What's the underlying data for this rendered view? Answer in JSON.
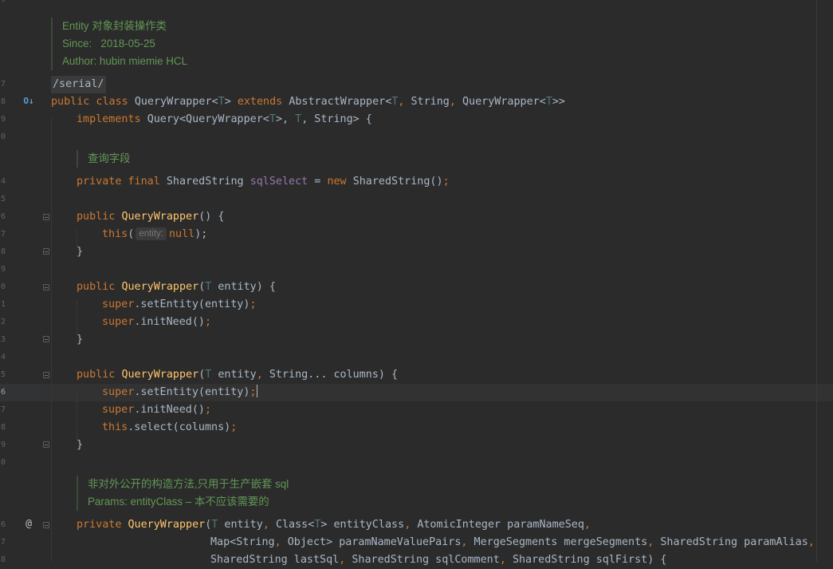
{
  "gutter": {
    "line_numbers": [
      "9",
      "7",
      "8",
      "9",
      "0",
      "4",
      "5",
      "6",
      "7",
      "8",
      "9",
      "0",
      "1",
      "2",
      "3",
      "4",
      "5",
      "6",
      "7",
      "8",
      "9",
      "0",
      "6",
      "7",
      "8"
    ],
    "implements_icon_label": "O↓",
    "annotation_icon_label": "@"
  },
  "doc_class": {
    "line1": "Entity 对象封装操作类",
    "line2": "Since:   2018-05-25",
    "line3": "Author: hubin miemie HCL"
  },
  "doc_field": {
    "line1": "查询字段"
  },
  "doc_ctor": {
    "line1": "非对外公开的构造方法,只用于生产嵌套 sql",
    "line2": "Params: entityClass – 本不应该需要的"
  },
  "code": {
    "serial": "/serial/",
    "l_class": {
      "kw1": "public class ",
      "name": "QueryWrapper",
      "t1": "<",
      "tp1": "T",
      "t2": "> ",
      "kw2": "extends ",
      "base": "AbstractWrapper<",
      "tp2": "T",
      "c1": ", ",
      "s1": "String",
      "c2": ", ",
      "q1": "QueryWrapper<",
      "tp3": "T",
      "end": ">>"
    },
    "l_impl": {
      "kw": "implements ",
      "a": "Query<QueryWrapper<",
      "tp1": "T",
      "b": ">, ",
      "tp2": "T",
      "c": ", String> {"
    },
    "l_field": {
      "kw": "private final ",
      "type": "SharedString ",
      "name": "sqlSelect",
      "eq": " = ",
      "kwnew": "new ",
      "rest": "SharedString()",
      "semi": ";"
    },
    "l_c1": {
      "kw": "public ",
      "name": "QueryWrapper",
      "rest": "() {"
    },
    "l_c1b": {
      "kw": "this",
      "p": "(",
      "hint": "entity:",
      "kwnull": "null",
      "end": ");"
    },
    "brace": "}",
    "l_c2": {
      "kw": "public ",
      "name": "QueryWrapper",
      "p": "(",
      "tp": "T",
      "rest": " entity) {"
    },
    "l_c2a": {
      "kw": "super",
      "rest": ".setEntity(entity)",
      "semi": ";"
    },
    "l_c2b": {
      "kw": "super",
      "rest": ".initNeed()",
      "semi": ";"
    },
    "l_c3": {
      "kw": "public ",
      "name": "QueryWrapper",
      "p": "(",
      "tp": "T",
      "a": " entity",
      "c1": ", ",
      "b": "String... columns) {"
    },
    "l_c3a": {
      "kw": "super",
      "rest": ".setEntity(entity)",
      "semi": ";"
    },
    "l_c3b": {
      "kw": "super",
      "rest": ".initNeed()",
      "semi": ";"
    },
    "l_c3c": {
      "kw": "this",
      "rest": ".select(columns)",
      "semi": ";"
    },
    "l_c4": {
      "kw": "private ",
      "name": "QueryWrapper",
      "p": "(",
      "tp1": "T",
      "a": " entity",
      "c1": ", ",
      "b": "Class<",
      "tp2": "T",
      "c": "> entityClass",
      "c2": ", ",
      "d": "AtomicInteger paramNameSeq",
      "c3": ","
    },
    "l_c4b": {
      "a": "Map<String",
      "c1": ", ",
      "b": "Object> paramNameValuePairs",
      "c2": ", ",
      "c": "MergeSegments mergeSegments",
      "c3": ", ",
      "d": "SharedString paramAlias",
      "c4": ","
    },
    "l_c4c": {
      "a": "SharedString lastSql",
      "c1": ", ",
      "b": "SharedString sqlComment",
      "c2": ", ",
      "c": "SharedString sqlFirst) {"
    }
  }
}
